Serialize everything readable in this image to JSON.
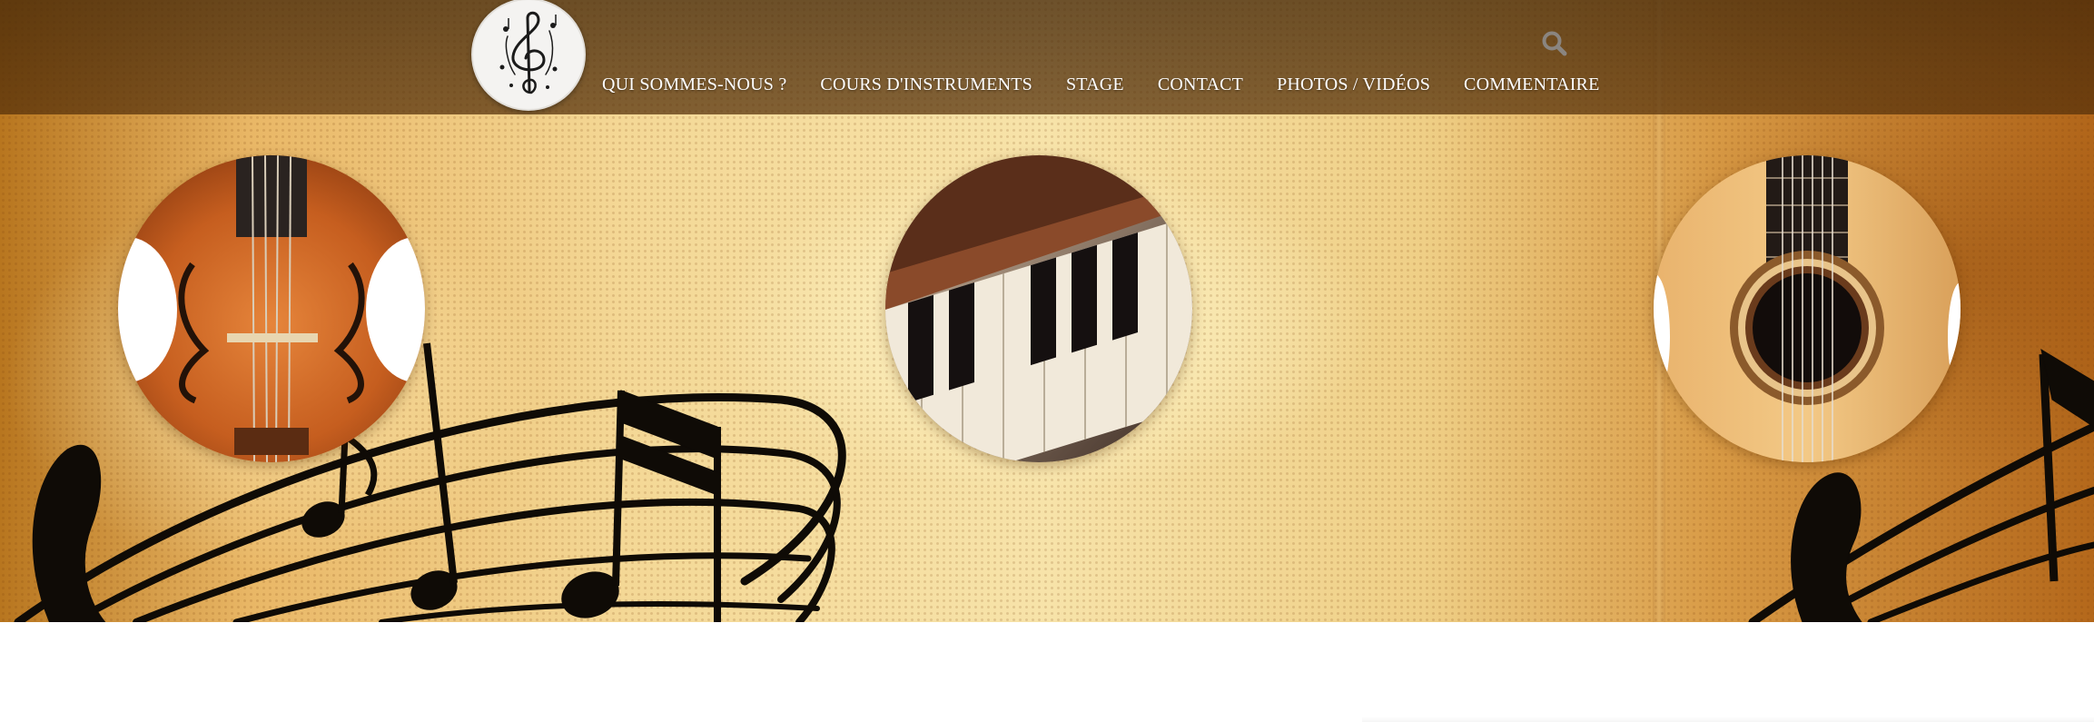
{
  "header": {
    "logo_icon": "treble-clef-icon",
    "search_icon": "search-icon",
    "nav": [
      {
        "label": "QUI SOMMES-NOUS ?"
      },
      {
        "label": "COURS D'INSTRUMENTS"
      },
      {
        "label": "STAGE"
      },
      {
        "label": "CONTACT"
      },
      {
        "label": "PHOTOS / VIDÉOS"
      },
      {
        "label": "COMMENTAIRE"
      }
    ]
  },
  "hero": {
    "images": [
      {
        "name": "violin",
        "icon": "violin-image"
      },
      {
        "name": "piano",
        "icon": "piano-image"
      },
      {
        "name": "guitar",
        "icon": "guitar-image"
      }
    ]
  },
  "colors": {
    "topbar": "#4a2a08",
    "nav_text": "#ffffff",
    "paper_light": "#f7e3a9",
    "paper_dark": "#b4681b",
    "notes": "#0f0b06"
  }
}
